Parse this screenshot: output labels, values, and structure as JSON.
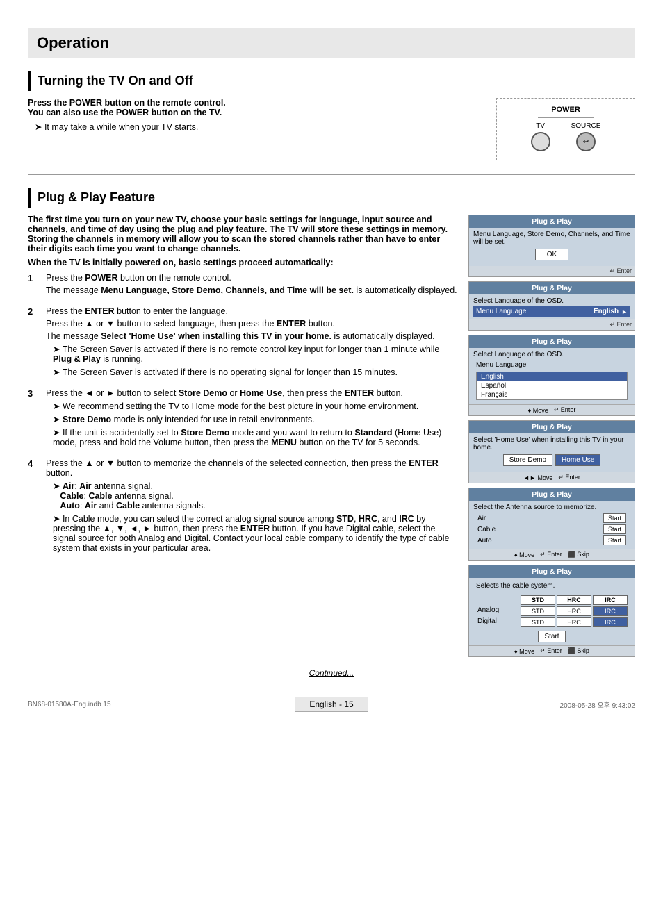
{
  "page": {
    "title": "Operation",
    "section1": {
      "heading": "Turning the TV On and Off",
      "intro_bold": "Press the POWER button on the remote control.\nYou can also use the POWER button on the TV.",
      "note": "It may take a while when your TV starts."
    },
    "section2": {
      "heading": "Plug & Play Feature",
      "intro": "The first time you turn on your new TV, choose your basic settings for language, input source and channels, and time of day using the plug and play feature. The TV will store these settings in memory. Storing the channels in memory will allow you to scan the stored channels rather than have to enter their digits each time you want to change channels.",
      "when_powered": "When the TV is initially powered on, basic settings proceed automatically:",
      "steps": [
        {
          "num": "1",
          "text": "Press the POWER button on the remote control.",
          "text2": "The message Menu Language, Store Demo, Channels, and Time will be set. is automatically displayed."
        },
        {
          "num": "2",
          "text": "Press the ENTER button to enter the language.",
          "text2": "Press the ▲ or ▼ button to select language, then press the ENTER button.",
          "text3": "The message Select 'Home Use' when installing this TV in your home. is automatically displayed.",
          "notes": [
            "The Screen Saver is activated if there is no remote control key input for longer than 1 minute while Plug & Play is running.",
            "The Screen Saver is activated if there is no operating signal for longer than 15 minutes."
          ]
        },
        {
          "num": "3",
          "text": "Press the ◄ or ► button to select Store Demo or Home Use, then press the ENTER button.",
          "notes": [
            "We recommend setting the TV to Home mode for the best picture in your home environment.",
            "Store Demo mode is only intended for use in retail environments.",
            "If the unit is accidentally set to Store Demo mode and you want to return to Standard (Home Use) mode, press and hold the Volume button, then press the MENU button on the TV for 5 seconds."
          ]
        },
        {
          "num": "4",
          "text": "Press the ▲ or ▼ button to memorize the channels of the selected connection, then press the ENTER button.",
          "notes_bold": [
            "Air: Air antenna signal.",
            "Cable: Cable antenna signal.",
            "Auto: Air and Cable antenna signals."
          ],
          "notes2": [
            "In Cable mode, you can select the correct analog signal source among STD, HRC, and IRC by pressing the ▲, ▼, ◄, ► button, then press the ENTER button. If you have Digital cable, select the signal source for both Analog and Digital. Contact your local cable company to identify the type of cable system that exists in your particular area."
          ]
        }
      ]
    },
    "osd_panels": [
      {
        "id": "panel1",
        "title": "Plug & Play",
        "body_text": "Menu Language, Store Demo, Channels, and Time will be set.",
        "has_ok": true,
        "ok_label": "OK",
        "enter_label": "↵ Enter"
      },
      {
        "id": "panel2",
        "title": "Plug & Play",
        "body_text": "Select Language of the OSD.",
        "row_label": "Menu Language",
        "row_value": "English",
        "enter_label": "↵ Enter"
      },
      {
        "id": "panel3",
        "title": "Plug & Play",
        "body_text": "Select Language of the OSD.",
        "row_label": "Menu Language",
        "dropdown_items": [
          "English",
          "Español",
          "Français"
        ],
        "selected_index": 0,
        "move_label": "♦ Move",
        "enter_label": "↵ Enter"
      },
      {
        "id": "panel4",
        "title": "Plug & Play",
        "body_text": "Select 'Home Use' when installing this TV in your home.",
        "buttons": [
          "Store Demo",
          "Home Use"
        ],
        "active_button": "Home Use",
        "move_label": "◄► Move",
        "enter_label": "↵ Enter"
      },
      {
        "id": "panel5",
        "title": "Plug & Play",
        "body_text": "Select the Antenna source to memorize.",
        "antenna_rows": [
          {
            "label": "Air",
            "btn": "Start"
          },
          {
            "label": "Cable",
            "btn": "Start"
          },
          {
            "label": "Auto",
            "btn": "Start"
          }
        ],
        "move_label": "♦ Move",
        "enter_label": "↵ Enter",
        "skip_label": "⬛ Skip"
      },
      {
        "id": "panel6",
        "title": "Plug & Play",
        "body_text": "Selects the cable system.",
        "cable_headers": [
          "",
          "STD",
          "HRC",
          "IRC"
        ],
        "cable_rows": [
          {
            "label": "Analog",
            "std": "STD",
            "hrc": "HRC",
            "irc": "IRC"
          },
          {
            "label": "Digital",
            "std": "STD",
            "hrc": "HRC",
            "irc": "IRC"
          }
        ],
        "start_label": "Start",
        "move_label": "♦ Move",
        "enter_label": "↵ Enter",
        "skip_label": "⬛ Skip"
      }
    ],
    "continued_label": "Continued...",
    "footer": {
      "page_label": "English - 15",
      "file_info": "BN68-01580A-Eng.indb   15",
      "date_info": "2008-05-28   오후 9:43:02"
    }
  }
}
